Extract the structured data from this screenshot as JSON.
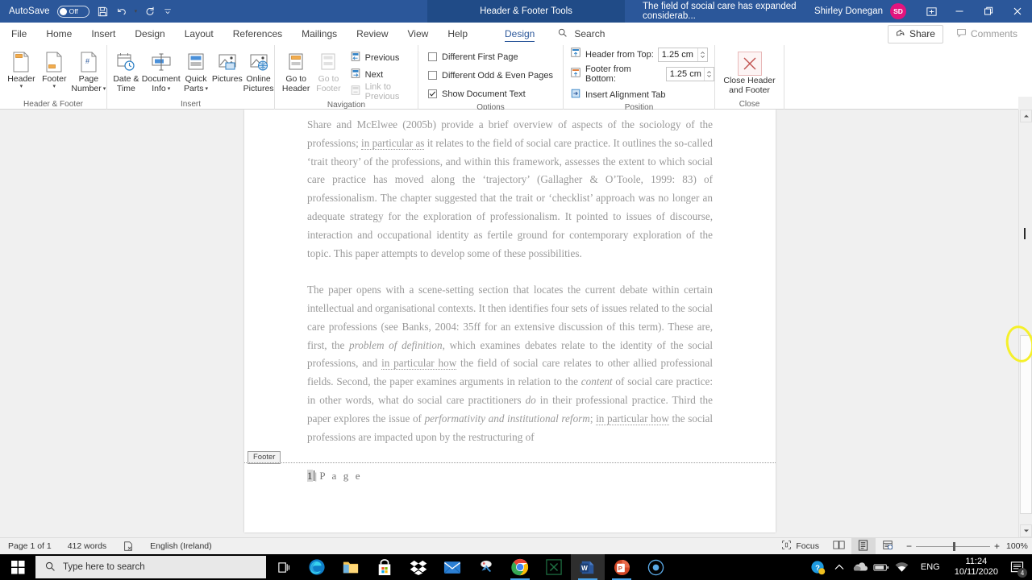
{
  "titlebar": {
    "autosave_label": "AutoSave",
    "autosave_state": "Off",
    "save_icon": "save-icon",
    "undo_icon": "undo-icon",
    "redo_icon": "redo-icon",
    "customize_icon": "customize-quick-access-icon",
    "context_tool_title": "Header & Footer Tools",
    "document_title": "The field of social care has expanded considerab...",
    "user_name": "Shirley Donegan",
    "user_initials": "SD",
    "ribbon_display_icon": "ribbon-display-options-icon",
    "minimize_icon": "minimize-icon",
    "restore_icon": "restore-icon",
    "close_icon": "close-icon",
    "accent_color": "#2b579a",
    "context_color": "#204b87",
    "avatar_color": "#e3147e"
  },
  "tabs": [
    {
      "label": "File",
      "active": false
    },
    {
      "label": "Home",
      "active": false
    },
    {
      "label": "Insert",
      "active": false
    },
    {
      "label": "Design",
      "active": false
    },
    {
      "label": "Layout",
      "active": false
    },
    {
      "label": "References",
      "active": false
    },
    {
      "label": "Mailings",
      "active": false
    },
    {
      "label": "Review",
      "active": false
    },
    {
      "label": "View",
      "active": false
    },
    {
      "label": "Help",
      "active": false
    }
  ],
  "contextual_tab": {
    "label": "Design",
    "active": true
  },
  "search": {
    "label": "Search",
    "icon": "search-icon"
  },
  "share": {
    "label": "Share",
    "icon": "share-icon"
  },
  "comments": {
    "label": "Comments",
    "icon": "comment-icon"
  },
  "ribbon": {
    "groups": [
      {
        "name": "header-footer",
        "label": "Header & Footer",
        "buttons": [
          {
            "label_line1": "Header",
            "label_line2": "",
            "icon": "header-icon",
            "dropdown": true,
            "disabled": false
          },
          {
            "label_line1": "Footer",
            "label_line2": "",
            "icon": "footer-icon",
            "dropdown": true,
            "disabled": false
          },
          {
            "label_line1": "Page",
            "label_line2": "Number",
            "icon": "page-number-icon",
            "dropdown": true,
            "disabled": false
          }
        ]
      },
      {
        "name": "insert",
        "label": "Insert",
        "buttons": [
          {
            "label_line1": "Date &",
            "label_line2": "Time",
            "icon": "date-time-icon",
            "dropdown": false,
            "disabled": false
          },
          {
            "label_line1": "Document",
            "label_line2": "Info",
            "icon": "document-info-icon",
            "dropdown": true,
            "disabled": false
          },
          {
            "label_line1": "Quick",
            "label_line2": "Parts",
            "icon": "quick-parts-icon",
            "dropdown": true,
            "disabled": false
          },
          {
            "label_line1": "Pictures",
            "label_line2": "",
            "icon": "pictures-icon",
            "dropdown": false,
            "disabled": false
          },
          {
            "label_line1": "Online",
            "label_line2": "Pictures",
            "icon": "online-pictures-icon",
            "dropdown": false,
            "disabled": false
          }
        ]
      },
      {
        "name": "navigation",
        "label": "Navigation",
        "buttons": [
          {
            "label_line1": "Go to",
            "label_line2": "Header",
            "icon": "go-to-header-icon",
            "dropdown": false,
            "disabled": false
          },
          {
            "label_line1": "Go to",
            "label_line2": "Footer",
            "icon": "go-to-footer-icon",
            "dropdown": false,
            "disabled": true
          }
        ],
        "small_buttons": [
          {
            "label": "Previous",
            "icon": "previous-icon",
            "disabled": false
          },
          {
            "label": "Next",
            "icon": "next-icon",
            "disabled": false
          },
          {
            "label": "Link to Previous",
            "icon": "link-to-previous-icon",
            "disabled": true
          }
        ]
      },
      {
        "name": "options",
        "label": "Options",
        "checkboxes": [
          {
            "label": "Different First Page",
            "checked": false
          },
          {
            "label": "Different Odd & Even Pages",
            "checked": false
          },
          {
            "label": "Show Document Text",
            "checked": true
          }
        ]
      },
      {
        "name": "position",
        "label": "Position",
        "fields": [
          {
            "label": "Header from Top:",
            "value": "1.25 cm",
            "icon": "header-from-top-icon"
          },
          {
            "label": "Footer from Bottom:",
            "value": "1.25 cm",
            "icon": "footer-from-bottom-icon"
          }
        ],
        "small_buttons": [
          {
            "label": "Insert Alignment Tab",
            "icon": "insert-alignment-tab-icon",
            "disabled": false
          }
        ]
      },
      {
        "name": "close",
        "label": "Close",
        "buttons": [
          {
            "label_line1": "Close Header",
            "label_line2": "and Footer",
            "icon": "close-header-footer-icon",
            "dropdown": false,
            "disabled": false
          }
        ]
      }
    ]
  },
  "document": {
    "paragraphs": [
      {
        "id": "p1",
        "runs": [
          {
            "text": "Share and McElwee (2005b) provide a brief overview of aspects of the sociology of the professions; ",
            "style": "normal"
          },
          {
            "text": "in particular as",
            "style": "grammar"
          },
          {
            "text": " it relates to the field of social care practice. It outlines the so-called ‘trait theory’ of the professions, and within this framework, assesses the extent to which social care practice has moved along the ‘trajectory’ (Gallagher & O’Toole, 1999: 83) of professionalism. The chapter suggested that the trait or ‘checklist’ approach was no longer an adequate strategy for the exploration of professionalism. It pointed to issues of discourse, interaction and occupational identity as fertile ground for contemporary exploration of the topic. This paper attempts to develop some of these possibilities.",
            "style": "normal"
          }
        ]
      },
      {
        "id": "p2",
        "runs": [
          {
            "text": "The paper opens with a scene-setting section that locates the current debate within certain intellectual and organisational contexts. It then identifies four sets of issues related to the social care professions (see Banks, 2004: 35ff for an extensive discussion of this term). These are, first, the ",
            "style": "normal"
          },
          {
            "text": "problem of definition",
            "style": "italic"
          },
          {
            "text": ", which examines debates relate to the identity of the social professions, and ",
            "style": "normal"
          },
          {
            "text": "in particular how",
            "style": "grammar"
          },
          {
            "text": " the field of social care relates to other allied professional fields. Second, the paper examines arguments in relation to the ",
            "style": "normal"
          },
          {
            "text": "content",
            "style": "italic"
          },
          {
            "text": " of social care practice: in other words, what do social care practitioners ",
            "style": "normal"
          },
          {
            "text": "do",
            "style": "italic"
          },
          {
            "text": " in their professional practice. Third the paper explores the issue of ",
            "style": "normal"
          },
          {
            "text": "performativity and institutional reform",
            "style": "italic"
          },
          {
            "text": "; ",
            "style": "normal"
          },
          {
            "text": "in particular how",
            "style": "grammar"
          },
          {
            "text": " the social professions are impacted upon by the restructuring of",
            "style": "normal"
          }
        ]
      }
    ],
    "footer_tag": "Footer",
    "footer_page_field": "1",
    "footer_separator": "|",
    "footer_label": "P a g e"
  },
  "statusbar": {
    "page_status": "Page 1 of 1",
    "word_count": "412 words",
    "proofing_icon": "proofing-errors-icon",
    "language": "English (Ireland)",
    "focus_label": "Focus",
    "focus_icon": "focus-mode-icon",
    "read_mode_icon": "read-mode-icon",
    "print_layout_icon": "print-layout-icon",
    "web_layout_icon": "web-layout-icon",
    "zoom_out": "−",
    "zoom_in": "+",
    "zoom_value": "100%"
  },
  "taskbar": {
    "start_icon": "windows-start-icon",
    "search_placeholder": "Type here to search",
    "search_icon": "search-icon",
    "task_view_icon": "task-view-icon",
    "apps": [
      {
        "name": "edge-icon",
        "running": false,
        "active": false
      },
      {
        "name": "file-explorer-icon",
        "running": false,
        "active": false
      },
      {
        "name": "microsoft-store-icon",
        "running": false,
        "active": false
      },
      {
        "name": "dropbox-icon",
        "running": false,
        "active": false
      },
      {
        "name": "mail-icon",
        "running": false,
        "active": false
      },
      {
        "name": "snip-sketch-icon",
        "running": false,
        "active": false
      },
      {
        "name": "chrome-icon",
        "running": true,
        "active": false
      },
      {
        "name": "excel-icon",
        "running": false,
        "active": false
      },
      {
        "name": "word-icon",
        "running": true,
        "active": true
      },
      {
        "name": "powerpoint-icon",
        "running": true,
        "active": false
      },
      {
        "name": "screen-recorder-icon",
        "running": false,
        "active": false
      }
    ],
    "tray": {
      "help_icon": "help-icon",
      "show_hidden_icon": "show-hidden-icons-icon",
      "onedrive_icon": "onedrive-icon",
      "battery_icon": "battery-icon",
      "network_icon": "wifi-icon",
      "language": "ENG",
      "time": "11:24",
      "date": "10/11/2020",
      "notification_icon": "action-center-icon",
      "notification_count": "4"
    }
  },
  "annotation": {
    "type": "highlight-circle",
    "color": "#f5f02a",
    "target": "scrollbar-thumb"
  }
}
